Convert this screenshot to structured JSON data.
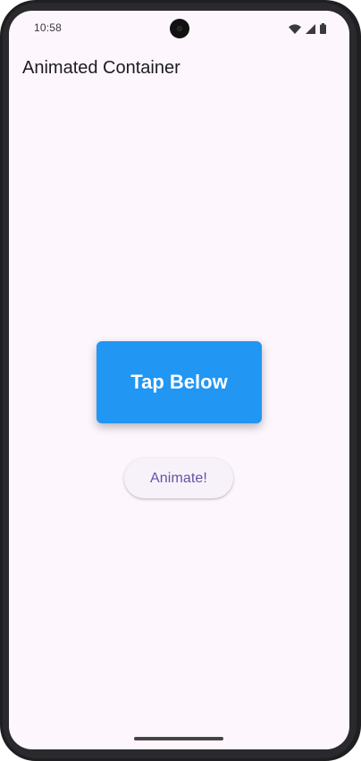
{
  "status_bar": {
    "time": "10:58",
    "icons": [
      "wifi-icon",
      "cellular-signal-icon",
      "battery-icon"
    ]
  },
  "app_bar": {
    "title": "Animated Container"
  },
  "animated_container": {
    "text": "Tap Below",
    "color": "#2196f3"
  },
  "animate_button": {
    "label": "Animate!"
  },
  "colors": {
    "screen_background": "#fdf6fd",
    "button_text": "#6750a4",
    "container_text": "#ffffff"
  }
}
